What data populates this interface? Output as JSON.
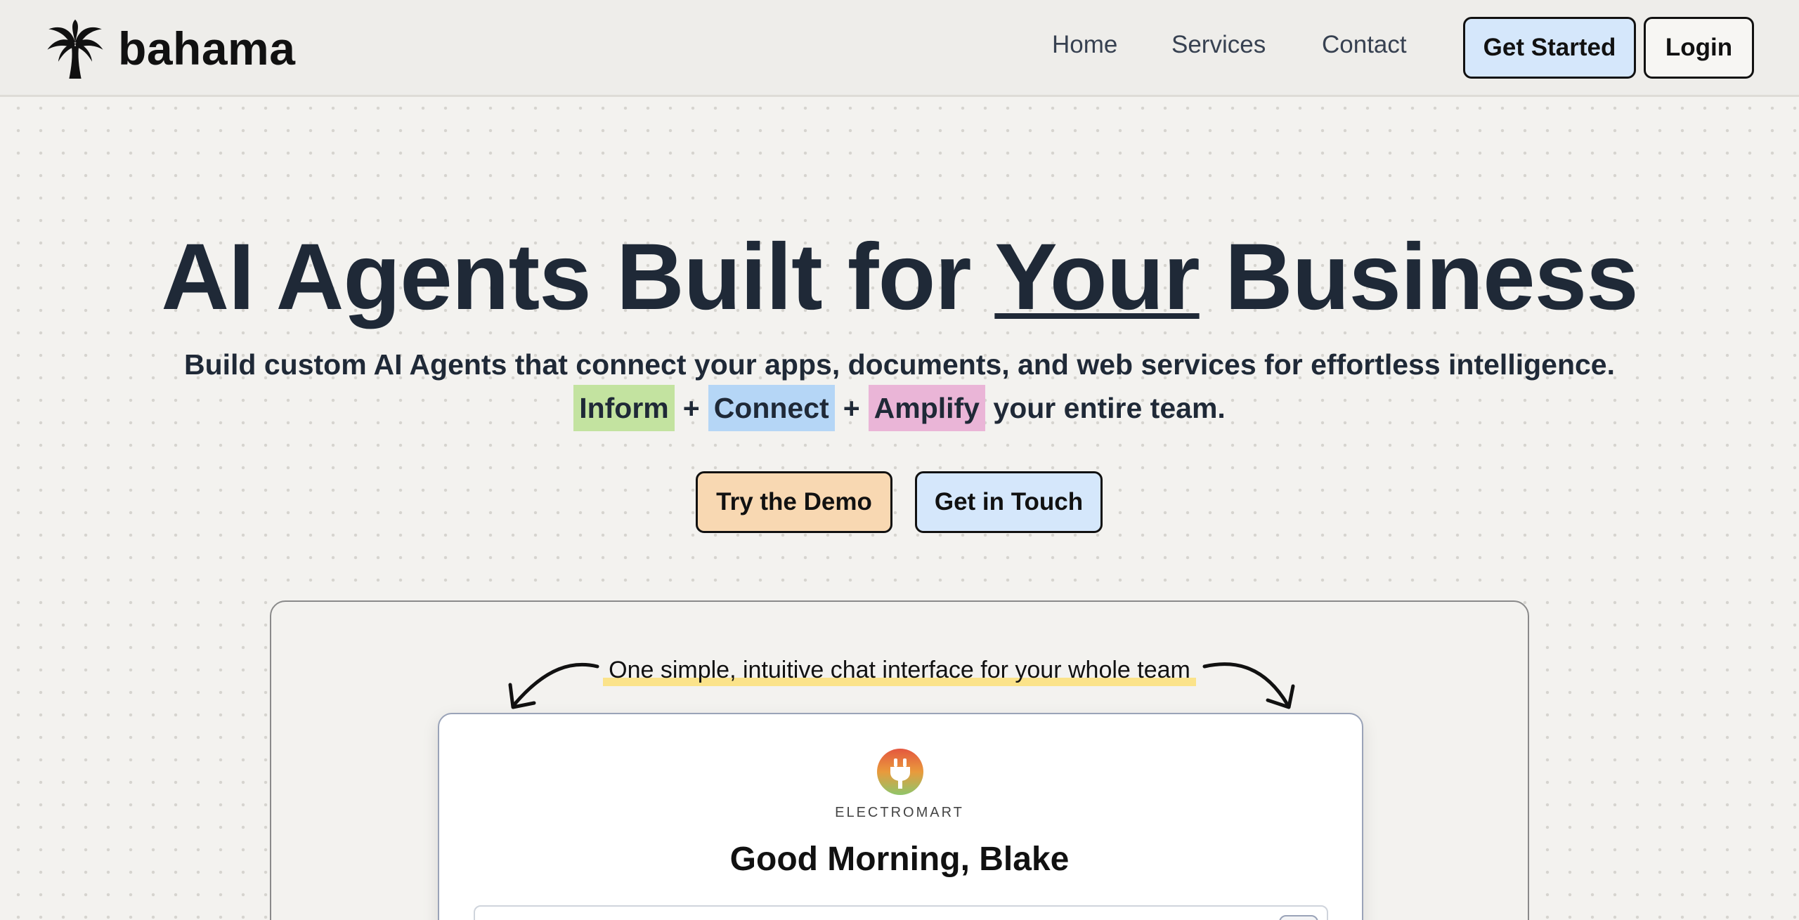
{
  "header": {
    "logo_text": "bahama",
    "logo_icon": "palm-tree-icon",
    "nav": [
      {
        "label": "Home"
      },
      {
        "label": "Services"
      },
      {
        "label": "Contact"
      }
    ],
    "get_started_label": "Get Started",
    "login_label": "Login"
  },
  "hero": {
    "title_part1": "AI Agents Built for ",
    "title_emphasis": "Your",
    "title_part2": " Business",
    "subtitle": "Build custom AI Agents that connect your apps, documents, and web services for effortless intelligence.",
    "pill_inform": "Inform",
    "pill_connect": "Connect",
    "pill_amplify": "Amplify",
    "plus": "+",
    "line2_suffix": "your entire team.",
    "demo_button_label": "Try the Demo",
    "touch_button_label": "Get in Touch"
  },
  "demo": {
    "caption": "One simple, intuitive chat interface for your whole team",
    "brand_name": "ELECTROMART",
    "brand_icon": "plug-icon",
    "greeting": "Good Morning, Blake"
  },
  "colors": {
    "background": "#f3f2ef",
    "text_dark": "#1f2937",
    "blue_button": "#d5e7fb",
    "orange_button": "#f8d8b2",
    "highlight_green": "#c3e3a0",
    "highlight_blue": "#b5d6f6",
    "highlight_pink": "#eab5d7",
    "caption_underline": "#fbe38a"
  }
}
